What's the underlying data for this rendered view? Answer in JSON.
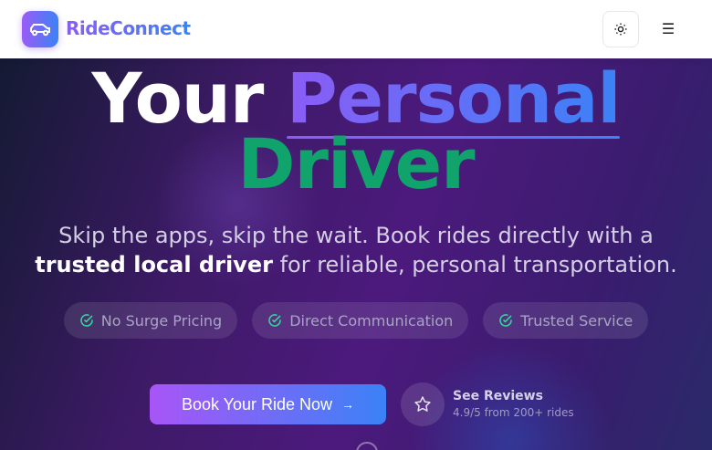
{
  "header": {
    "brand": "RideConnect",
    "logo_icon": "car-icon",
    "theme_icon": "sun-icon",
    "menu_icon": "hamburger-icon",
    "menu_glyph": "☰"
  },
  "hero": {
    "title_part1": "Your",
    "title_highlight": "Personal",
    "title_line2": "Driver",
    "subtitle_before": "Skip the apps, skip the wait. Book rides directly with a ",
    "subtitle_bold": "trusted local driver",
    "subtitle_after": " for reliable, personal transportation.",
    "features": [
      "No Surge Pricing",
      "Direct Communication",
      "Trusted Service"
    ],
    "cta_label": "Book Your Ride Now",
    "cta_arrow": "→",
    "reviews_title": "See Reviews",
    "reviews_subtitle": "4.9/5 from 200+ rides"
  },
  "colors": {
    "accent_start": "#8b5cf6",
    "accent_end": "#3b82f6",
    "driver_green": "#10a36b",
    "check_green": "#34d399"
  }
}
